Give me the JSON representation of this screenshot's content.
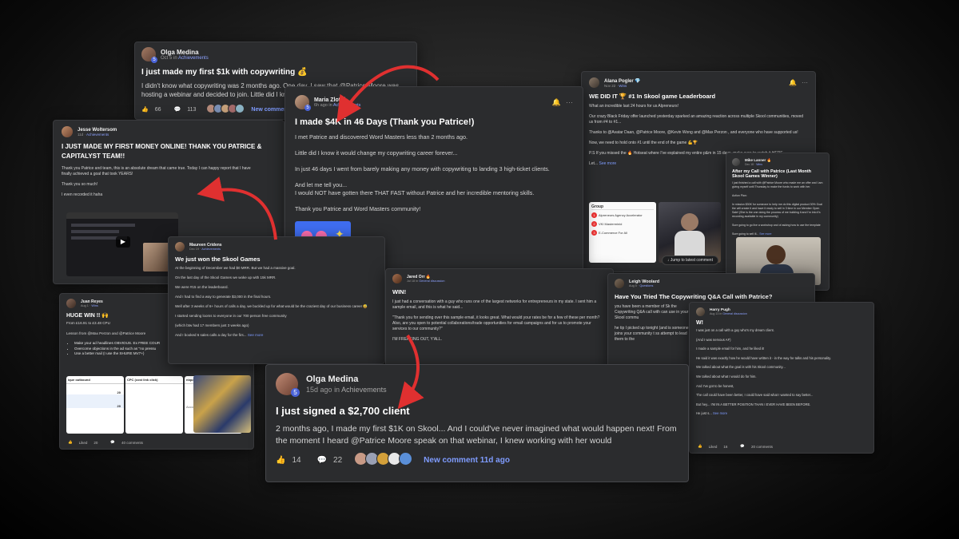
{
  "posts": {
    "p1": {
      "name": "Olga Medina",
      "time": "Oct 5",
      "cat": "Achievements",
      "title": "I just made my first $1k with copywriting 💰",
      "body": "I didn't know what copywriting was 2 months ago. One day, I saw that @Patrice Moore was hosting a webinar and decided to join. Little did I know that de",
      "likes": "66",
      "comments": "113",
      "new": "New comment"
    },
    "p2": {
      "name": "Jesse Woltersom",
      "time": "11d",
      "cat": "Achievements",
      "title": "I JUST MADE MY FIRST MONEY ONLINE! THANK YOU PATRICE & CAPITALYST TEAM!!",
      "b1": "Thank you Patrice and team, this is an absolute dream that came true. Today I can happy report that I have finally achieved a goal that took YEARS!",
      "b2": "Thank you so much!",
      "b3": "I even recorded it haha"
    },
    "p3": {
      "name": "Maria Zlotni",
      "time": "6h ago",
      "cat": "Achievements",
      "title": "I made $4K in 46 Days (Thank you Patrice!)",
      "b1": "I met Patrice and discovered Word Masters less than 2 months ago.",
      "b2": "Little did I know it would change my copywriting career forever...",
      "b3": "In just 46 days I went from barely making any money with copywriting to landing 3 high-ticket clients.",
      "b4": "And let me tell you...",
      "b5": "I would NOT have gotten there THAT FAST without Patrice and her incredible mentoring skills.",
      "b6": "Thank you Patrice and Word Masters community!"
    },
    "p4": {
      "name": "Alana Pogler 💎",
      "time": "Nov 22",
      "cat": "Wins",
      "title": "WE DID IT 🏆 #1 In Skool game Leaderboard",
      "b1": "What an incredible last 24 hours for us Alpreneurs!",
      "b2": "Our crazy Black Friday offer launched yesterday sparked an amazing reaction across multiple Skool communities, moved us from #4 to #1...",
      "b3": "Thanks to @Avatar Daan, @Patrice Moore, @Kevin Wong and @Max Perzon , and everyone who have supported us!",
      "b4": "Now, we need to hold onto #1 until the end of the game 💪🏆",
      "b5": "P.S If you missed the 🔥 Hotseat where I've explained my entire p&m in 15 days, make sure to watch it HERE.",
      "more": "See more",
      "jump": "Jump to latest comment",
      "lb_title": "Group",
      "lb1": "Alpreneurs Agency Accelerator",
      "lb2": "VKI Masterminid",
      "lb3": "E-Commerce For All"
    },
    "p5": {
      "name": "Mike Lanner 🔥",
      "time": "Dec 18",
      "cat": "Wins",
      "title": "After my Call with Patrice (Last Month Skool Games Winner)",
      "b1": "I just finished a call with @Patrice Moore who made me an offer and I am giving myself until Thursday to make the funds to work with her.",
      "b2": "Action Plan:",
      "b3": "In mission $30K for someone to help me do this digital product 30% Goal the will create it and have it ready to sell in 3 time in our Member Open Sale! (She is the one doing the process of me building it and I'm into it's recording available in my community)",
      "b4": "Sure going to go live a workshop and of asking how to use the template",
      "b5": "Sure going to sell ill...",
      "more": "See more"
    },
    "p6": {
      "name": "Maureen Cridens",
      "time": "Dec 19",
      "cat": "Achievements",
      "title": "We just won the Skool Games",
      "b1": "At the beginning of December we had $0 MRR. But we had a massive goal.",
      "b2": "On the last day of the Skool Games we woke up with 15k MRR.",
      "b3": "We were #15 on the leaderboard.",
      "b4": "And I had to find a way to generate $3,000 in the final hours.",
      "b5": "Well after 3 weeks of 6+ hours of calls a day, we buckled up for what would be the craziest day of our business career 😅",
      "b6": "I started sending looms to everyone in our 700 person free community",
      "b7": "(which btw had 17 members just 3 weeks ago)",
      "b8": "And I booked 6 sales calls a day for the firs...",
      "more": "See more"
    },
    "p7": {
      "name": "Juan Reyes",
      "time": "Aug 1",
      "cat": "Wins",
      "title": "HUGE WIN !! 🙌",
      "b1": "From £16.91 to £3.48 CPL!",
      "b2": "Lesson from @Max Perzon and @Patrice Moore",
      "li1": "Make your ad headlines OBVIOUS. Ex FREE COUR",
      "li2": "Overcome objections in the ad such as \"no pressu",
      "li3": "Use a better mail (I use the SHURE MV7+)",
      "th1": "ique outbound",
      "th2": "CPC (cost link click)",
      "th3": "nique CTR (link click-through rate)",
      "th4": "Unique clicks",
      "r1": "20",
      "r2": "20",
      "pct1": "3.00%",
      "pct2": "3.00%",
      "acct": "Accounts Center a...",
      "liked": "Liked",
      "likes": "20",
      "comments": "40 comments"
    },
    "p8": {
      "name": "Jared Orr 🔥",
      "time": "Jul 18",
      "cat": "General discussion",
      "title": "WIN!",
      "b1": "I just had a conversation with a guy who runs one of the largest networks for entrepreneurs in my state. I sent him a sample email, and this is what he said...",
      "b2": "\"Thank you for sending over this sample email, it looks great. What would your rates be for a few of these per month? Also, are you open to potential collaborations/trade opportunities for email campaigns and for us to promote your services to our community?\"",
      "b3": "I'M FREAKING OUT, Y'ALL."
    },
    "p9": {
      "name": "Leigh Woolard",
      "time": "Aug 5",
      "cat": "Questions",
      "title": "Have You Tried The Copywriting Q&A Call with Patrice?",
      "b1": "you have been a member of Sk the Copywriting Q&A call with can use in your Skool commu",
      "b2": "he tip I picked up tonight (and is someone joins your community t ss attempt to lead them to the"
    },
    "p10": {
      "name": "Harry Pugh",
      "time": "Aug 13",
      "cat": "General discussion",
      "title": "W!",
      "b1": "I was just on a call with a guy who's my dream client.",
      "b2": "(And I was nervous AF)",
      "b3": "I made a sample email for him, and he liked it!",
      "b4": "He said it was exactly how he would have written it - in the way he talks and his personality.",
      "b5": "We talked about what the goal is with his Skool community...",
      "b6": "We talked about what I would do for him.",
      "b7": "And I've got to be honest,",
      "b8": "The call could have been better, I could have said what I wanted to say better...",
      "b9": "But hey... I'M IN A BETTER POSITION THAN I EVER HAVE BEEN BEFORE.",
      "b10": "He just s...",
      "more": "See more",
      "liked": "Liked",
      "likes": "16",
      "comments": "20 comments"
    },
    "p11": {
      "name": "Olga Medina",
      "time": "15d ago",
      "in": "in",
      "cat": "Achievements",
      "title": "I just signed a $2,700 client",
      "body": "2 months ago, I made my first $1K on Skool... And I could've never imagined what would happen next! From the moment I heard @Patrice Moore speak on that webinar, I knew working with her would",
      "likes": "14",
      "comments": "22",
      "new": "New comment 11d ago"
    }
  },
  "colors": {
    "accent": "#7f9cff",
    "arrow": "#e03030",
    "card": "#2b2c2e"
  }
}
